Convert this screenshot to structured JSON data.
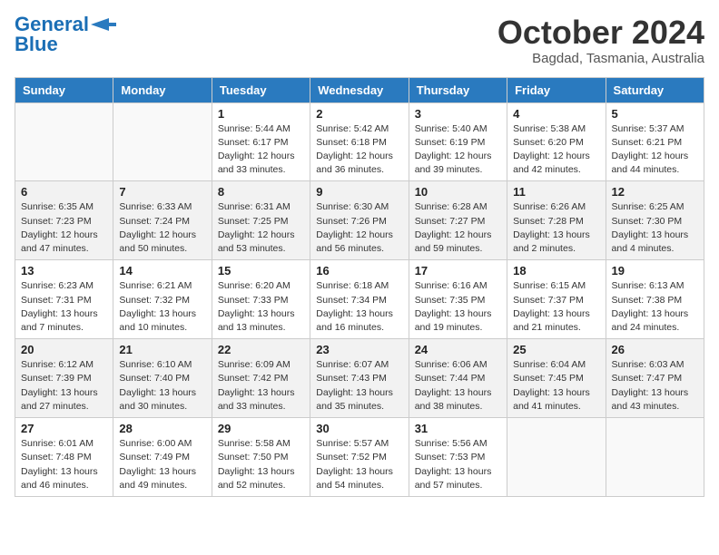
{
  "header": {
    "logo_line1": "General",
    "logo_line2": "Blue",
    "month": "October 2024",
    "location": "Bagdad, Tasmania, Australia"
  },
  "days_of_week": [
    "Sunday",
    "Monday",
    "Tuesday",
    "Wednesday",
    "Thursday",
    "Friday",
    "Saturday"
  ],
  "weeks": [
    [
      {
        "day": "",
        "info": ""
      },
      {
        "day": "",
        "info": ""
      },
      {
        "day": "1",
        "info": "Sunrise: 5:44 AM\nSunset: 6:17 PM\nDaylight: 12 hours and 33 minutes."
      },
      {
        "day": "2",
        "info": "Sunrise: 5:42 AM\nSunset: 6:18 PM\nDaylight: 12 hours and 36 minutes."
      },
      {
        "day": "3",
        "info": "Sunrise: 5:40 AM\nSunset: 6:19 PM\nDaylight: 12 hours and 39 minutes."
      },
      {
        "day": "4",
        "info": "Sunrise: 5:38 AM\nSunset: 6:20 PM\nDaylight: 12 hours and 42 minutes."
      },
      {
        "day": "5",
        "info": "Sunrise: 5:37 AM\nSunset: 6:21 PM\nDaylight: 12 hours and 44 minutes."
      }
    ],
    [
      {
        "day": "6",
        "info": "Sunrise: 6:35 AM\nSunset: 7:23 PM\nDaylight: 12 hours and 47 minutes."
      },
      {
        "day": "7",
        "info": "Sunrise: 6:33 AM\nSunset: 7:24 PM\nDaylight: 12 hours and 50 minutes."
      },
      {
        "day": "8",
        "info": "Sunrise: 6:31 AM\nSunset: 7:25 PM\nDaylight: 12 hours and 53 minutes."
      },
      {
        "day": "9",
        "info": "Sunrise: 6:30 AM\nSunset: 7:26 PM\nDaylight: 12 hours and 56 minutes."
      },
      {
        "day": "10",
        "info": "Sunrise: 6:28 AM\nSunset: 7:27 PM\nDaylight: 12 hours and 59 minutes."
      },
      {
        "day": "11",
        "info": "Sunrise: 6:26 AM\nSunset: 7:28 PM\nDaylight: 13 hours and 2 minutes."
      },
      {
        "day": "12",
        "info": "Sunrise: 6:25 AM\nSunset: 7:30 PM\nDaylight: 13 hours and 4 minutes."
      }
    ],
    [
      {
        "day": "13",
        "info": "Sunrise: 6:23 AM\nSunset: 7:31 PM\nDaylight: 13 hours and 7 minutes."
      },
      {
        "day": "14",
        "info": "Sunrise: 6:21 AM\nSunset: 7:32 PM\nDaylight: 13 hours and 10 minutes."
      },
      {
        "day": "15",
        "info": "Sunrise: 6:20 AM\nSunset: 7:33 PM\nDaylight: 13 hours and 13 minutes."
      },
      {
        "day": "16",
        "info": "Sunrise: 6:18 AM\nSunset: 7:34 PM\nDaylight: 13 hours and 16 minutes."
      },
      {
        "day": "17",
        "info": "Sunrise: 6:16 AM\nSunset: 7:35 PM\nDaylight: 13 hours and 19 minutes."
      },
      {
        "day": "18",
        "info": "Sunrise: 6:15 AM\nSunset: 7:37 PM\nDaylight: 13 hours and 21 minutes."
      },
      {
        "day": "19",
        "info": "Sunrise: 6:13 AM\nSunset: 7:38 PM\nDaylight: 13 hours and 24 minutes."
      }
    ],
    [
      {
        "day": "20",
        "info": "Sunrise: 6:12 AM\nSunset: 7:39 PM\nDaylight: 13 hours and 27 minutes."
      },
      {
        "day": "21",
        "info": "Sunrise: 6:10 AM\nSunset: 7:40 PM\nDaylight: 13 hours and 30 minutes."
      },
      {
        "day": "22",
        "info": "Sunrise: 6:09 AM\nSunset: 7:42 PM\nDaylight: 13 hours and 33 minutes."
      },
      {
        "day": "23",
        "info": "Sunrise: 6:07 AM\nSunset: 7:43 PM\nDaylight: 13 hours and 35 minutes."
      },
      {
        "day": "24",
        "info": "Sunrise: 6:06 AM\nSunset: 7:44 PM\nDaylight: 13 hours and 38 minutes."
      },
      {
        "day": "25",
        "info": "Sunrise: 6:04 AM\nSunset: 7:45 PM\nDaylight: 13 hours and 41 minutes."
      },
      {
        "day": "26",
        "info": "Sunrise: 6:03 AM\nSunset: 7:47 PM\nDaylight: 13 hours and 43 minutes."
      }
    ],
    [
      {
        "day": "27",
        "info": "Sunrise: 6:01 AM\nSunset: 7:48 PM\nDaylight: 13 hours and 46 minutes."
      },
      {
        "day": "28",
        "info": "Sunrise: 6:00 AM\nSunset: 7:49 PM\nDaylight: 13 hours and 49 minutes."
      },
      {
        "day": "29",
        "info": "Sunrise: 5:58 AM\nSunset: 7:50 PM\nDaylight: 13 hours and 52 minutes."
      },
      {
        "day": "30",
        "info": "Sunrise: 5:57 AM\nSunset: 7:52 PM\nDaylight: 13 hours and 54 minutes."
      },
      {
        "day": "31",
        "info": "Sunrise: 5:56 AM\nSunset: 7:53 PM\nDaylight: 13 hours and 57 minutes."
      },
      {
        "day": "",
        "info": ""
      },
      {
        "day": "",
        "info": ""
      }
    ]
  ]
}
